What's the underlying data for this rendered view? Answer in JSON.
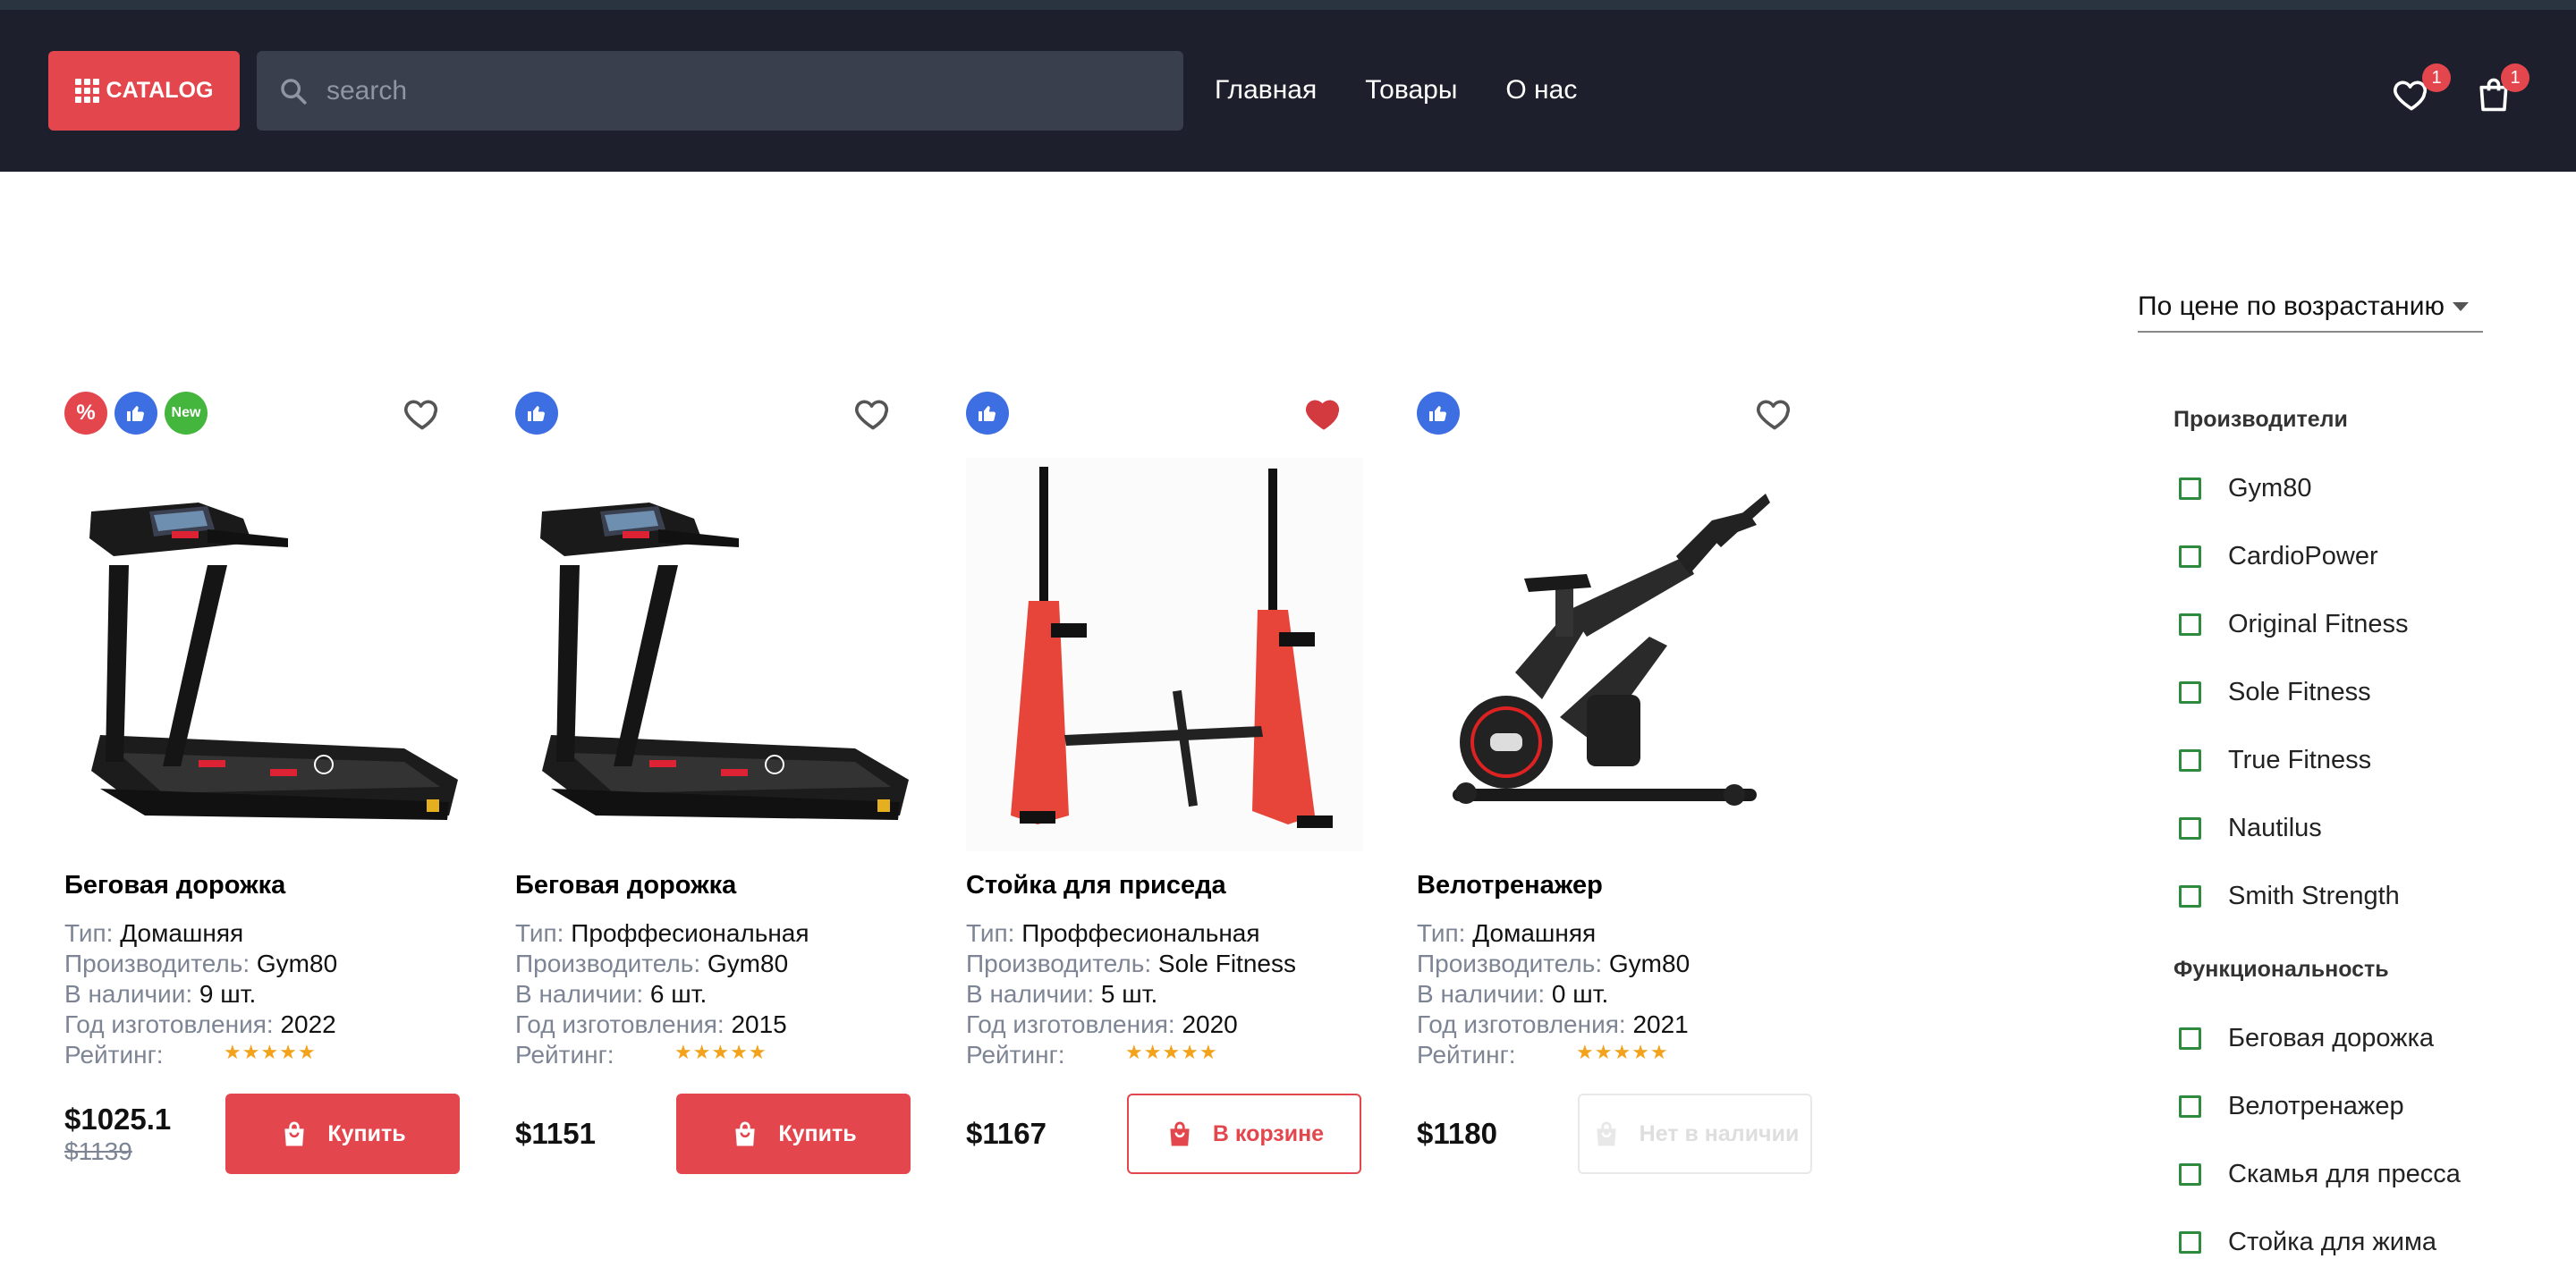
{
  "header": {
    "catalog_label": "CATALOG",
    "search_placeholder": "search",
    "nav": [
      "Главная",
      "Товары",
      "О нас"
    ],
    "favorites_count": "1",
    "cart_count": "1"
  },
  "sort": {
    "selected": "По цене по возрастанию"
  },
  "labels": {
    "type": "Тип:",
    "manufacturer": "Производитель:",
    "stock": "В наличии:",
    "year": "Год изготовления:",
    "rating": "Рейтинг:"
  },
  "products": [
    {
      "title": "Беговая дорожка",
      "type": "Домашняя",
      "manufacturer": "Gym80",
      "stock": "9 шт.",
      "year": "2022",
      "rating": 5,
      "price": "$1025.1",
      "old_price": "$1139",
      "button": "Купить",
      "badges": [
        "%",
        "like-icon",
        "New"
      ],
      "favorite": false
    },
    {
      "title": "Беговая дорожка",
      "type": "Проффесиональная",
      "manufacturer": "Gym80",
      "stock": "6 шт.",
      "year": "2015",
      "rating": 5,
      "price": "$1151",
      "button": "Купить",
      "badges": [
        "like-icon"
      ],
      "favorite": false
    },
    {
      "title": "Стойка для приседа",
      "type": "Проффесиональная",
      "manufacturer": "Sole Fitness",
      "stock": "5 шт.",
      "year": "2020",
      "rating": 5,
      "price": "$1167",
      "button": "В корзине",
      "badges": [
        "like-icon"
      ],
      "favorite": true
    },
    {
      "title": "Велотренажер",
      "type": "Домашняя",
      "manufacturer": "Gym80",
      "stock": "0 шт.",
      "year": "2021",
      "rating": 5,
      "price": "$1180",
      "button": "Нет в наличии",
      "badges": [
        "like-icon"
      ],
      "favorite": false
    }
  ],
  "filters": {
    "manufacturers_heading": "Производители",
    "manufacturers": [
      "Gym80",
      "CardioPower",
      "Original Fitness",
      "Sole Fitness",
      "True Fitness",
      "Nautilus",
      "Smith Strength"
    ],
    "functionality_heading": "Функциональность",
    "functionality": [
      "Беговая дорожка",
      "Велотренажер",
      "Скамья для пресса",
      "Стойка для жима"
    ]
  },
  "colors": {
    "accent": "#e3474d",
    "header_bg": "#1d1f2c",
    "like_badge": "#3d6fe3",
    "new_badge": "#44b63d",
    "checkbox": "#2e8b3e",
    "star": "#f2a31b"
  }
}
